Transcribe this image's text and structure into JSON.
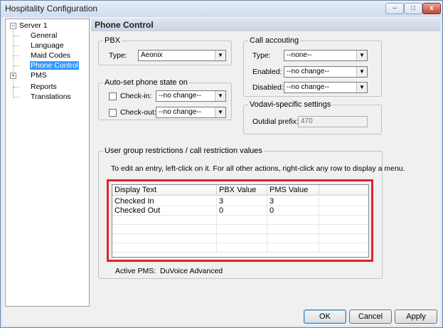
{
  "window": {
    "title": "Hospitality Configuration",
    "minimize": "–",
    "maximize": "□",
    "close": "x"
  },
  "tree": {
    "root": "Server 1",
    "root_expander": "−",
    "items": [
      "General",
      "Language",
      "Maid Codes",
      "Phone Control"
    ],
    "pms": "PMS",
    "pms_expander": "+",
    "after": [
      "Reports",
      "Translations"
    ],
    "selected": "Phone Control"
  },
  "panel": {
    "title": "Phone Control",
    "pbx": {
      "legend": "PBX",
      "type_label": "Type:",
      "type_value": "Aeonix"
    },
    "autoset": {
      "legend": "Auto-set phone state on",
      "checkin_label": "Check-in:",
      "checkin_value": "--no change--",
      "checkout_label": "Check-out:",
      "checkout_value": "--no change--"
    },
    "call_accounting": {
      "legend": "Call accouting",
      "type_label": "Type:",
      "type_value": "--none--",
      "enabled_label": "Enabled:",
      "enabled_value": "--no change--",
      "disabled_label": "Disabled:",
      "disabled_value": "--no change--"
    },
    "vodavi": {
      "legend": "Vodavi-specific settings",
      "outdial_label": "Outdial prefix:",
      "outdial_value": "470"
    },
    "restrictions": {
      "legend": "User group restrictions / call restriction values",
      "hint": "To edit an entry, left-click on it.  For all other actions, right-click any row to display a menu.",
      "columns": [
        "Display Text",
        "PBX Value",
        "PMS Value"
      ],
      "rows": [
        [
          "Checked In",
          "3",
          "3"
        ],
        [
          "Checked Out",
          "0",
          "0"
        ]
      ],
      "active_pms_label": "Active PMS:",
      "active_pms_value": "DuVoice Advanced"
    }
  },
  "buttons": {
    "ok": "OK",
    "cancel": "Cancel",
    "apply": "Apply"
  },
  "colors": {
    "selection": "#3399ff",
    "highlight_border": "#e8202a"
  }
}
